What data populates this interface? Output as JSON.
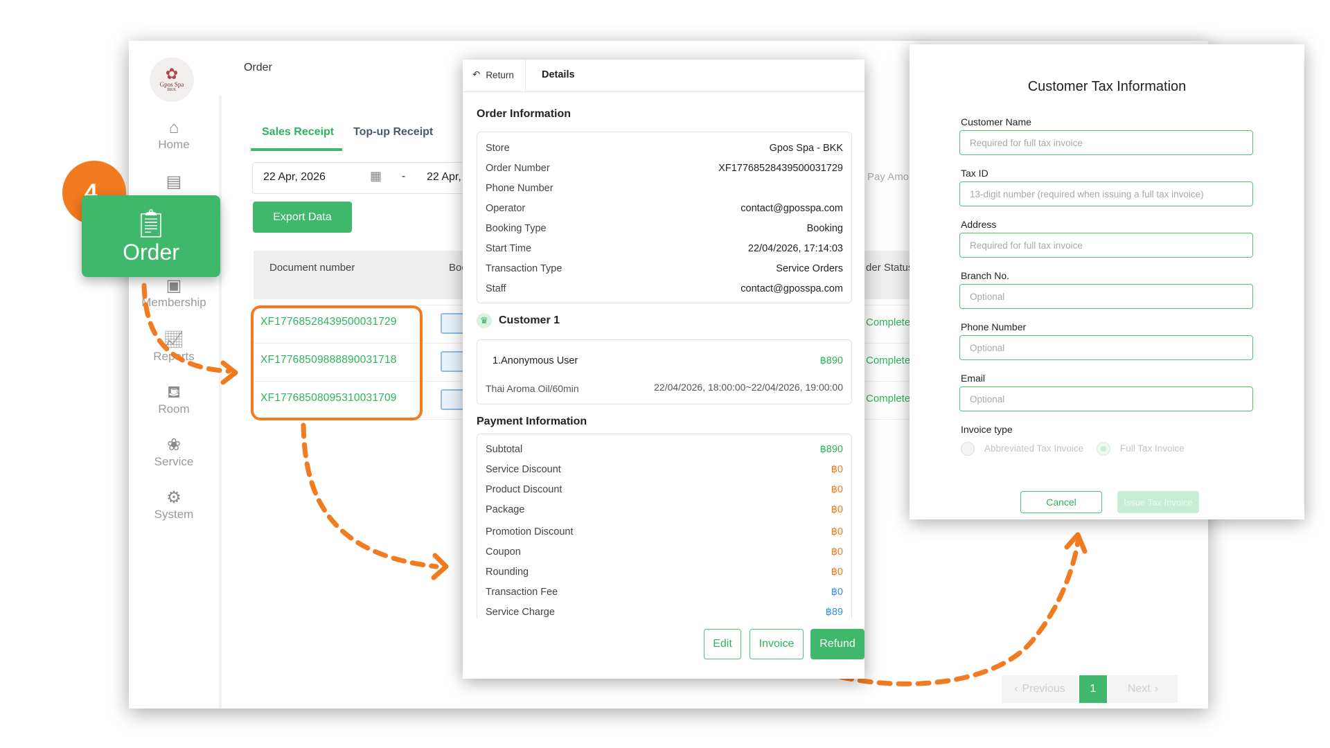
{
  "app": {
    "brand": "Gpos Spa",
    "brand_sub": "BKK",
    "page_title": "Order",
    "nav": [
      {
        "label": "Home",
        "icon": "house-icon"
      },
      {
        "label": "",
        "icon": "cash-register-icon"
      },
      {
        "label": "Membership",
        "icon": "membership-card-icon"
      },
      {
        "label": "Reports",
        "icon": "chart-icon"
      },
      {
        "label": "Room",
        "icon": "bed-icon"
      },
      {
        "label": "Service",
        "icon": "lotus-icon"
      },
      {
        "label": "System",
        "icon": "gear-icon"
      }
    ],
    "tabs": [
      "Sales Receipt",
      "Top-up Receipt"
    ],
    "date_from": "22 Apr, 2026",
    "date_sep": "-",
    "date_to": "22 Apr,",
    "pay_amount_placeholder": "Pay Amou",
    "export_label": "Export Data",
    "table_headers": [
      "Document number",
      "Boo",
      "der Status"
    ],
    "orders": [
      {
        "doc": "XF17768528439500031729",
        "status": "Completed"
      },
      {
        "doc": "XF17768509888890031718",
        "status": "Completed"
      },
      {
        "doc": "XF17768508095310031709",
        "status": "Completed"
      }
    ],
    "pagination": {
      "prev": "Previous",
      "page": "1",
      "next": "Next"
    }
  },
  "callout": {
    "step": "4.",
    "label": "Order"
  },
  "details": {
    "return_label": "Return",
    "tab_label": "Details",
    "order_info_title": "Order Information",
    "order_info": [
      {
        "label": "Store",
        "value": "Gpos Spa - BKK"
      },
      {
        "label": "Order Number",
        "value": "XF17768528439500031729"
      },
      {
        "label": "Phone Number",
        "value": ""
      },
      {
        "label": "Operator",
        "value": "contact@gposspa.com"
      },
      {
        "label": "Booking Type",
        "value": "Booking"
      },
      {
        "label": "Start Time",
        "value": "22/04/2026, 17:14:03"
      },
      {
        "label": "Transaction Type",
        "value": "Service Orders"
      },
      {
        "label": "Staff",
        "value": "contact@gposspa.com"
      }
    ],
    "customer_title": "Customer 1",
    "customer_name": "1.Anonymous User",
    "customer_amount": "฿890",
    "service_name": "Thai Aroma Oil/60min",
    "service_time": "22/04/2026, 18:00:00~22/04/2026, 19:00:00",
    "payment_title": "Payment Information",
    "payment": [
      {
        "label": "Subtotal",
        "value": "฿890",
        "tone": "green"
      },
      {
        "label": "Service Discount",
        "value": "฿0",
        "tone": "orange"
      },
      {
        "label": "Product Discount",
        "value": "฿0",
        "tone": "orange"
      },
      {
        "label": "Package",
        "value": "฿0",
        "tone": "orange"
      },
      {
        "label": "Promotion Discount",
        "value": "฿0",
        "tone": "orange"
      },
      {
        "label": "Coupon",
        "value": "฿0",
        "tone": "orange"
      },
      {
        "label": "Rounding",
        "value": "฿0",
        "tone": "orange"
      },
      {
        "label": "Transaction Fee",
        "value": "฿0",
        "tone": "blue"
      },
      {
        "label": "Service Charge",
        "value": "฿89",
        "tone": "blue"
      }
    ],
    "buttons": {
      "edit": "Edit",
      "invoice": "Invoice",
      "refund": "Refund"
    }
  },
  "tax": {
    "title": "Customer Tax Information",
    "fields": [
      {
        "label": "Customer Name",
        "placeholder": "Required for full tax invoice"
      },
      {
        "label": "Tax ID",
        "placeholder": "13-digit number (required when issuing a full tax invoice)"
      },
      {
        "label": "Address",
        "placeholder": "Required for full tax invoice"
      },
      {
        "label": "Branch No.",
        "placeholder": "Optional"
      },
      {
        "label": "Phone Number",
        "placeholder": "Optional"
      },
      {
        "label": "Email",
        "placeholder": "Optional"
      }
    ],
    "invoice_type_label": "Invoice type",
    "options": [
      "Abbreviated Tax Invoice",
      "Full Tax Invoice"
    ],
    "cancel": "Cancel",
    "issue": "Issue Tax Invoice"
  },
  "colors": {
    "accent_green": "#3fb86b",
    "annotation_orange": "#f27a1f"
  }
}
